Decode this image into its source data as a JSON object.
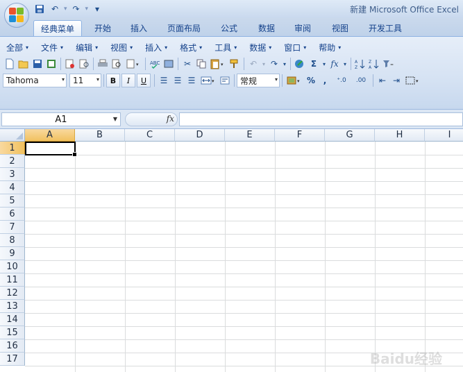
{
  "window": {
    "title": "新建 Microsoft Office Excel"
  },
  "quick_access": [
    {
      "name": "save-icon",
      "glyph": "💾"
    },
    {
      "name": "undo-icon",
      "glyph": "↶"
    },
    {
      "name": "redo-icon",
      "glyph": "↷"
    },
    {
      "name": "customize-qat-icon",
      "glyph": "▾"
    }
  ],
  "tabs": [
    {
      "label": "经典菜单",
      "active": true
    },
    {
      "label": "开始"
    },
    {
      "label": "插入"
    },
    {
      "label": "页面布局"
    },
    {
      "label": "公式"
    },
    {
      "label": "数据"
    },
    {
      "label": "审阅"
    },
    {
      "label": "视图"
    },
    {
      "label": "开发工具"
    }
  ],
  "menus": [
    "全部",
    "文件",
    "编辑",
    "视图",
    "插入",
    "格式",
    "工具",
    "数据",
    "窗口",
    "帮助"
  ],
  "format_toolbar": {
    "font_name": "Tahoma",
    "font_size": "11",
    "bold": "B",
    "italic": "I",
    "underline": "U",
    "number_format": "常规",
    "percent": "%",
    "comma": ",",
    "increase_decimal": "⁺.0",
    "decrease_decimal": ".00"
  },
  "formula_bar": {
    "name_box": "A1",
    "fx": "fx",
    "formula": ""
  },
  "columns": [
    "A",
    "B",
    "C",
    "D",
    "E",
    "F",
    "G",
    "H",
    "I"
  ],
  "rows": [
    "1",
    "2",
    "3",
    "4",
    "5",
    "6",
    "7",
    "8",
    "9",
    "10",
    "11",
    "12",
    "13",
    "14",
    "15",
    "16",
    "17"
  ],
  "active_cell": "A1",
  "watermark": "Baidu经验"
}
